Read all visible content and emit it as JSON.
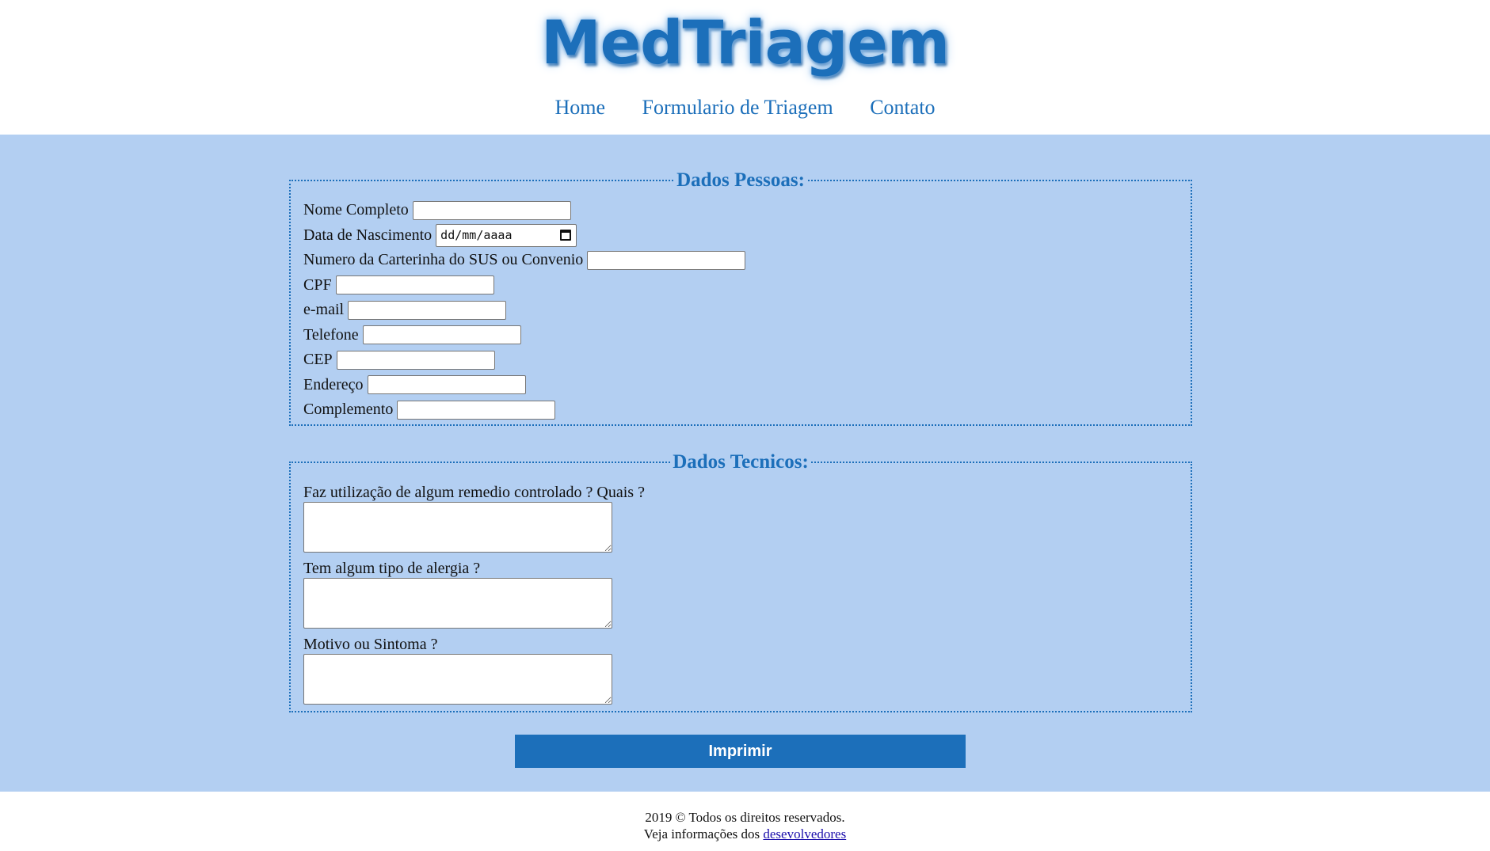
{
  "header": {
    "logo_text": "MedTriagem",
    "nav": [
      "Home",
      "Formulario de Triagem",
      "Contato"
    ]
  },
  "form": {
    "personal": {
      "legend": "Dados Pessoas:",
      "fields": [
        {
          "label": "Nome Completo",
          "value": ""
        },
        {
          "label": "Data de Nascimento",
          "value": "dd/mm/aaaa"
        },
        {
          "label": "Numero da Carterinha do SUS ou Convenio",
          "value": ""
        },
        {
          "label": "CPF",
          "value": ""
        },
        {
          "label": "e-mail",
          "value": ""
        },
        {
          "label": "Telefone",
          "value": ""
        },
        {
          "label": "CEP",
          "value": ""
        },
        {
          "label": "Endereço",
          "value": ""
        },
        {
          "label": "Complemento",
          "value": ""
        }
      ]
    },
    "technical": {
      "legend": "Dados Tecnicos:",
      "questions": [
        "Faz utilização de algum remedio controlado ? Quais ?",
        "Tem algum tipo de alergia ?",
        "Motivo ou Sintoma ?"
      ]
    },
    "submit_label": "Imprimir"
  },
  "footer": {
    "copyright": "2019 © Todos os direitos reservados.",
    "dev_prefix": "Veja informações dos ",
    "dev_link": "desevolvedores"
  },
  "colors": {
    "accent": "#1c6fba",
    "background": "#b3cff2"
  }
}
